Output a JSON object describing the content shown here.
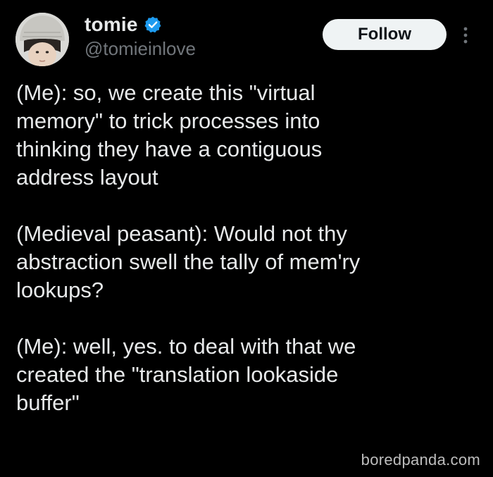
{
  "author": {
    "display_name": "tomie",
    "handle": "@tomieinlove",
    "verified": true,
    "verified_color": "#1d9bf0",
    "avatar_icon": "profile-photo-avatar"
  },
  "actions": {
    "follow_label": "Follow",
    "more_icon": "more-vertical-icon"
  },
  "tweet": {
    "paragraphs": [
      "(Me): so, we create this \"virtual\nmemory\" to trick processes into\nthinking they have a contiguous\naddress layout",
      "(Medieval peasant): Would not thy\nabstraction swell the tally of mem'ry\nlookups?",
      "(Me): well, yes. to deal with that we\ncreated the \"translation lookaside\nbuffer\""
    ]
  },
  "watermark": "boredpanda.com",
  "colors": {
    "background": "#000000",
    "text_primary": "#e7e9ea",
    "text_secondary": "#71767b",
    "button_bg": "#eff3f4",
    "button_text": "#0f1419"
  }
}
